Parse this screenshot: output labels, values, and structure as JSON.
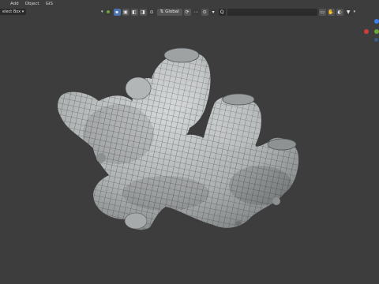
{
  "menu": {
    "add": "Add",
    "object": "Object",
    "gis": "GIS"
  },
  "toolbar": {
    "select_mode": "elect Box",
    "transform_orientation": "Global",
    "orientation_glyph": "⇅",
    "snap_glyph": "⊙",
    "proportional_glyph": "⟳",
    "search_glyph": "Q"
  },
  "viewport": {
    "background": "#3d3d3d",
    "mesh_color": "#b9bcbd"
  },
  "gizmo": {
    "x_color": "#d23b3b",
    "y_color": "#6aa538",
    "z_color": "#3f7ee6"
  }
}
